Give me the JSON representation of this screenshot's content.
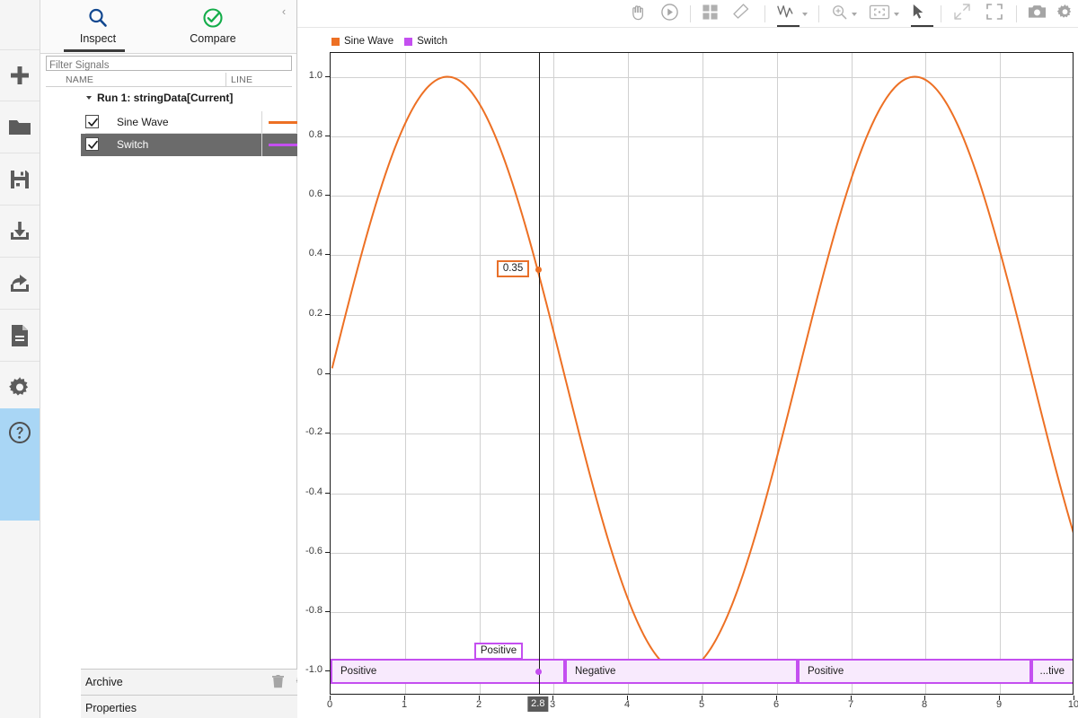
{
  "rail": {
    "items": [
      {
        "name": "new",
        "icon": "plus-icon"
      },
      {
        "name": "open",
        "icon": "folder-icon"
      },
      {
        "name": "save",
        "icon": "save-icon"
      },
      {
        "name": "import",
        "icon": "import-icon"
      },
      {
        "name": "export",
        "icon": "export-icon"
      },
      {
        "name": "report",
        "icon": "report-icon"
      },
      {
        "name": "preferences",
        "icon": "gear-icon"
      }
    ],
    "help": {
      "name": "help",
      "icon": "help-icon"
    }
  },
  "browser": {
    "tabs": [
      {
        "label": "Inspect",
        "icon": "magnifier-icon",
        "active": true
      },
      {
        "label": "Compare",
        "icon": "check-circle-icon",
        "active": false
      }
    ],
    "collapse_glyph": "‹",
    "filter": {
      "value": "",
      "placeholder": "Filter Signals"
    },
    "columns": {
      "name": "NAME",
      "line": "LINE"
    },
    "run": {
      "label": "Run 1: stringData[Current]",
      "status_color": "#1eb21e",
      "expanded": true
    },
    "signals": [
      {
        "name": "Sine Wave",
        "checked": true,
        "color": "#ed7024",
        "selected": false
      },
      {
        "name": "Switch",
        "checked": true,
        "color": "#c44ff0",
        "selected": true
      }
    ]
  },
  "panels": [
    {
      "title": "Archive",
      "icons": [
        "trash-icon",
        "gear-icon",
        "chevron-up-icon"
      ]
    },
    {
      "title": "Properties",
      "icons": [
        "chevron-up-icon"
      ]
    }
  ],
  "toolbar": {
    "items": [
      {
        "name": "pan-tool",
        "icon": "hand-icon",
        "caret": false,
        "active": false
      },
      {
        "name": "replay-tool",
        "icon": "play-circle-icon",
        "caret": false,
        "active": false
      },
      {
        "name": "layout-tool",
        "icon": "grid-icon",
        "caret": false,
        "active": false
      },
      {
        "name": "clear-tool",
        "icon": "eraser-icon",
        "caret": false,
        "active": false
      },
      {
        "name": "cursors-tool",
        "icon": "signal-cursor-icon",
        "caret": true,
        "active": true
      },
      {
        "name": "zoom-tool",
        "icon": "zoom-in-icon",
        "caret": true,
        "active": false
      },
      {
        "name": "fit-to-view-tool",
        "icon": "fit-view-icon",
        "caret": true,
        "active": false
      },
      {
        "name": "pointer-tool",
        "icon": "arrow-pointer-icon",
        "caret": false,
        "active": true
      },
      {
        "name": "expand-tool",
        "icon": "diagonal-arrows-icon",
        "caret": false,
        "active": false
      },
      {
        "name": "fullscreen-tool",
        "icon": "fullscreen-icon",
        "caret": false,
        "active": false
      },
      {
        "name": "snapshot-tool",
        "icon": "camera-icon",
        "caret": false,
        "active": false
      },
      {
        "name": "settings-tool",
        "icon": "gear-icon",
        "caret": false,
        "active": false
      }
    ]
  },
  "chart_data": {
    "type": "line",
    "title": "",
    "xlabel": "",
    "ylabel": "",
    "xlim": [
      0,
      10
    ],
    "ylim": [
      -1.08,
      1.08
    ],
    "grid": true,
    "legend_position": "top-left",
    "xticks": [
      "0",
      "1",
      "2",
      "3",
      "4",
      "5",
      "6",
      "7",
      "8",
      "9",
      "10"
    ],
    "xtick_values": [
      0,
      1,
      2,
      3,
      4,
      5,
      6,
      7,
      8,
      9,
      10
    ],
    "yticks": [
      "1.0",
      "0.8",
      "0.6",
      "0.4",
      "0.2",
      "0",
      "-0.2",
      "-0.4",
      "-0.6",
      "-0.8",
      "-1.0"
    ],
    "ytick_values": [
      1.0,
      0.8,
      0.6,
      0.4,
      0.2,
      0,
      -0.2,
      -0.4,
      -0.6,
      -0.8,
      -1.0
    ],
    "series": [
      {
        "name": "Sine Wave",
        "color": "#ed7024",
        "type": "line",
        "formula": "sin(x)",
        "x_start": 0.02,
        "x_end": 10.0
      },
      {
        "name": "Switch",
        "color": "#c44ff0",
        "type": "string-band",
        "y": -1.0,
        "segments": [
          {
            "label": "Positive",
            "x_start": 0.0,
            "x_end": 3.15
          },
          {
            "label": "Negative",
            "x_start": 3.15,
            "x_end": 6.28
          },
          {
            "label": "Positive",
            "x_start": 6.28,
            "x_end": 9.42
          },
          {
            "label": "...tive",
            "x_start": 9.42,
            "x_end": 10.0,
            "truncated": true,
            "full_label": "Positive"
          }
        ]
      }
    ],
    "cursor": {
      "x_value": 2.8,
      "x_label": "2.8",
      "datatips": [
        {
          "series": "Sine Wave",
          "value": "0.35",
          "color": "#ed7024",
          "y": 0.35
        },
        {
          "series": "Switch",
          "value": "Positive",
          "color": "#c44ff0",
          "y": -1.0
        }
      ]
    }
  },
  "legend": [
    {
      "label": "Sine Wave",
      "color": "#ed7024"
    },
    {
      "label": "Switch",
      "color": "#c44ff0"
    }
  ]
}
